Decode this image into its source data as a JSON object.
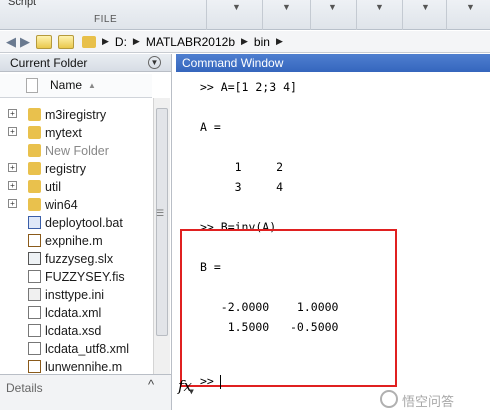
{
  "ribbon": {
    "script_label": "Script",
    "file_label": "FILE"
  },
  "pathbar": {
    "crumbs": [
      "D:",
      "MATLABR2012b",
      "bin"
    ]
  },
  "current_folder": {
    "title": "Current Folder",
    "column_name": "Name",
    "items": [
      {
        "name": "m3iregistry",
        "type": "folder",
        "expandable": true,
        "gray": false
      },
      {
        "name": "mytext",
        "type": "folder",
        "expandable": true,
        "gray": false
      },
      {
        "name": "New Folder",
        "type": "folder",
        "expandable": false,
        "gray": true
      },
      {
        "name": "registry",
        "type": "folder",
        "expandable": true,
        "gray": false
      },
      {
        "name": "util",
        "type": "folder",
        "expandable": true,
        "gray": false
      },
      {
        "name": "win64",
        "type": "folder",
        "expandable": true,
        "gray": false
      },
      {
        "name": "deploytool.bat",
        "type": "bat",
        "expandable": false,
        "gray": false
      },
      {
        "name": "expnihe.m",
        "type": "m",
        "expandable": false,
        "gray": false
      },
      {
        "name": "fuzzyseg.slx",
        "type": "slx",
        "expandable": false,
        "gray": false
      },
      {
        "name": "FUZZYSEY.fis",
        "type": "file",
        "expandable": false,
        "gray": false
      },
      {
        "name": "insttype.ini",
        "type": "ini",
        "expandable": false,
        "gray": false
      },
      {
        "name": "lcdata.xml",
        "type": "xml",
        "expandable": false,
        "gray": false
      },
      {
        "name": "lcdata.xsd",
        "type": "xml",
        "expandable": false,
        "gray": false
      },
      {
        "name": "lcdata_utf8.xml",
        "type": "xml",
        "expandable": false,
        "gray": false
      },
      {
        "name": "lunwennihe.m",
        "type": "m",
        "expandable": false,
        "gray": false
      }
    ],
    "details_label": "Details"
  },
  "command_window": {
    "title": "Command Window",
    "lines": [
      ">> A=[1 2;3 4]",
      "A =",
      "     1     2",
      "     3     4",
      ">> B=inv(A)",
      "B =",
      "   -2.0000    1.0000",
      "    1.5000   -0.5000",
      ">> "
    ],
    "fx_symbol": "fx"
  },
  "watermark": {
    "text": "悟空问答"
  }
}
